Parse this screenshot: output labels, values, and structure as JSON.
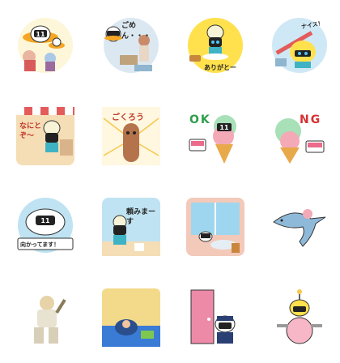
{
  "stickers": [
    {
      "name": "robot-and-dog-scientists",
      "text": ""
    },
    {
      "name": "sorry-apology",
      "text": "ごめん・・・"
    },
    {
      "name": "thank-you",
      "text": "ありがとー"
    },
    {
      "name": "bat-swing",
      "text": "ナイス！"
    },
    {
      "name": "what-is-it",
      "text": "なにとぞ〜"
    },
    {
      "name": "good-job",
      "text": "ごくろう"
    },
    {
      "name": "ok-ice-cream",
      "text": "OK"
    },
    {
      "name": "ng-ice-cream",
      "text": "NG"
    },
    {
      "name": "on-my-way",
      "text": "向かってます！"
    },
    {
      "name": "please",
      "text": "頼みまーす"
    },
    {
      "name": "window-view",
      "text": ""
    },
    {
      "name": "dolphin",
      "text": ""
    },
    {
      "name": "baseball-catcher",
      "text": ""
    },
    {
      "name": "diver",
      "text": ""
    },
    {
      "name": "door-police",
      "text": ""
    },
    {
      "name": "pink-ball-robot",
      "text": ""
    }
  ]
}
